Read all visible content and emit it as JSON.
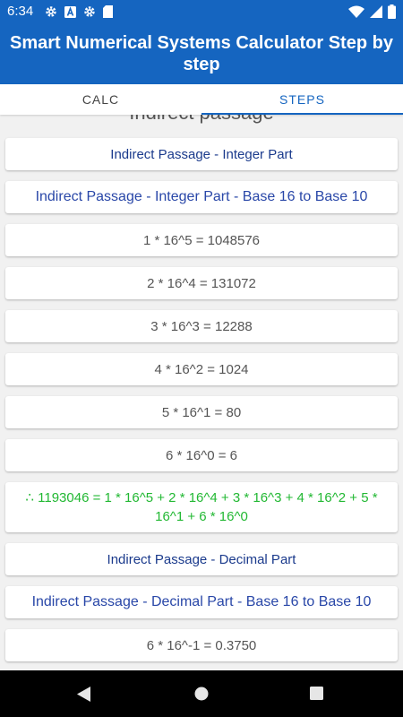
{
  "status": {
    "time": "6:34"
  },
  "app": {
    "title": "Smart Numerical Systems Calculator Step by step"
  },
  "tabs": [
    {
      "label": "CALC"
    },
    {
      "label": "STEPS"
    }
  ],
  "steps": {
    "partial_heading": "Indirect passage",
    "items": [
      {
        "text": "Indirect Passage - Integer Part"
      },
      {
        "text": "Indirect Passage - Integer Part - Base 16 to Base 10"
      },
      {
        "text": "1 * 16^5 = 1048576"
      },
      {
        "text": "2 * 16^4 = 131072"
      },
      {
        "text": "3 * 16^3 = 12288"
      },
      {
        "text": "4 * 16^2 = 1024"
      },
      {
        "text": "5 * 16^1 = 80"
      },
      {
        "text": "6 * 16^0 = 6"
      },
      {
        "text": "∴ 1193046 = 1 * 16^5 + 2 * 16^4 + 3 * 16^3 + 4 * 16^2 + 5 * 16^1 + 6 * 16^0"
      },
      {
        "text": "Indirect Passage - Decimal Part"
      },
      {
        "text": "Indirect Passage - Decimal Part - Base 16 to Base 10"
      },
      {
        "text": "6 * 16^-1 = 0.3750"
      }
    ]
  },
  "colors": {
    "primary": "#1565c0",
    "heading_text": "#1a3a8c",
    "subheading_text": "#2947a8",
    "step_text": "#555555",
    "result_text": "#22b833"
  },
  "icons": {
    "status_left": [
      "gear-icon",
      "font-a-icon",
      "gear-icon",
      "sd-card-icon"
    ],
    "status_right": [
      "wifi-icon",
      "signal-icon",
      "battery-icon"
    ],
    "nav": [
      "back-icon",
      "home-icon",
      "recents-icon"
    ]
  }
}
